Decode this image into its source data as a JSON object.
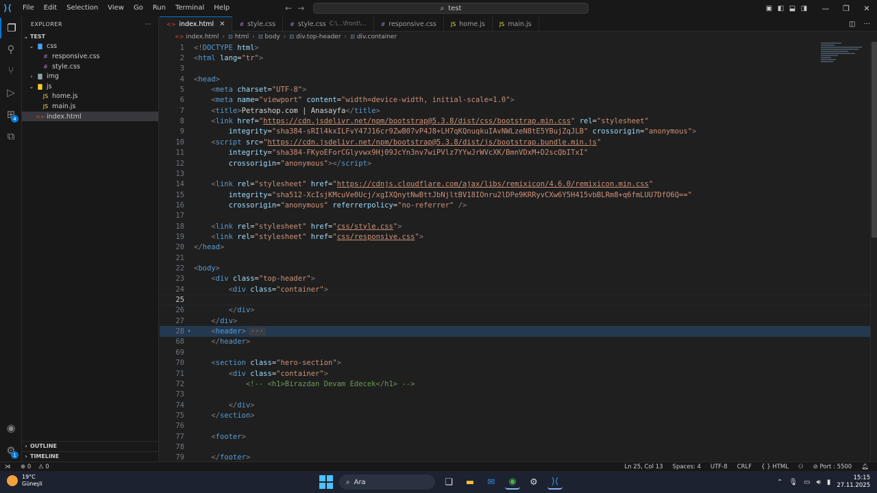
{
  "titlebar": {
    "menu": [
      "File",
      "Edit",
      "Selection",
      "View",
      "Go",
      "Run",
      "Terminal",
      "Help"
    ],
    "search": "test",
    "icons": [
      "vscode-logo",
      "back-arrow",
      "forward-arrow",
      "toggle-sidebar",
      "toggle-panel",
      "toggle-secondary-sidebar",
      "customize-layout",
      "minimize",
      "maximize",
      "close"
    ]
  },
  "activitybar": {
    "items": [
      "explorer",
      "search",
      "source-control",
      "run-and-debug",
      "extensions",
      "remote-explorer"
    ],
    "extensions_badge": "4",
    "manage_badge": "1"
  },
  "sidebar": {
    "title": "EXPLORER",
    "root": "TEST",
    "tree": [
      {
        "label": "css",
        "type": "folder-css",
        "depth": 1,
        "open": true
      },
      {
        "label": "responsive.css",
        "type": "css",
        "depth": 2
      },
      {
        "label": "style.css",
        "type": "css",
        "depth": 2
      },
      {
        "label": "img",
        "type": "folder",
        "depth": 1,
        "open": false
      },
      {
        "label": "js",
        "type": "folder-js",
        "depth": 1,
        "open": true
      },
      {
        "label": "home.js",
        "type": "js",
        "depth": 2
      },
      {
        "label": "main.js",
        "type": "js",
        "depth": 2
      },
      {
        "label": "index.html",
        "type": "html",
        "depth": 1,
        "selected": true
      }
    ],
    "outline": "OUTLINE",
    "timeline": "TIMELINE"
  },
  "tabs": [
    {
      "label": "index.html",
      "type": "html",
      "active": true,
      "desc": ""
    },
    {
      "label": "style.css",
      "type": "css",
      "active": false,
      "desc": ""
    },
    {
      "label": "style.css",
      "type": "css",
      "active": false,
      "desc": "C:\\...\\front\\..."
    },
    {
      "label": "responsive.css",
      "type": "css",
      "active": false,
      "desc": ""
    },
    {
      "label": "home.js",
      "type": "js",
      "active": false,
      "desc": ""
    },
    {
      "label": "main.js",
      "type": "js",
      "active": false,
      "desc": ""
    }
  ],
  "breadcrumb": [
    "index.html",
    "html",
    "body",
    "div.top-header",
    "div.container"
  ],
  "code_lines": [
    {
      "n": "1",
      "html": "<span class='t'>&lt;!</span><span class='tn'>DOCTYPE</span> <span class='an'>html</span><span class='t'>&gt;</span>"
    },
    {
      "n": "2",
      "html": "<span class='t'>&lt;</span><span class='tn'>html</span> <span class='an'>lang</span><span class='tx'>=</span><span class='av'>\"tr\"</span><span class='t'>&gt;</span>"
    },
    {
      "n": "3",
      "html": ""
    },
    {
      "n": "4",
      "html": "<span class='t'>&lt;</span><span class='tn'>head</span><span class='t'>&gt;</span>"
    },
    {
      "n": "5",
      "html": "    <span class='t'>&lt;</span><span class='tn'>meta</span> <span class='an'>charset</span><span class='tx'>=</span><span class='av'>\"UTF-8\"</span><span class='t'>&gt;</span>"
    },
    {
      "n": "6",
      "html": "    <span class='t'>&lt;</span><span class='tn'>meta</span> <span class='an'>name</span><span class='tx'>=</span><span class='av'>\"viewport\"</span> <span class='an'>content</span><span class='tx'>=</span><span class='av'>\"width=device-width, initial-scale=1.0\"</span><span class='t'>&gt;</span>"
    },
    {
      "n": "7",
      "html": "    <span class='t'>&lt;</span><span class='tn'>title</span><span class='t'>&gt;</span><span class='tx'>Petrashop.com | Anasayfa</span><span class='t'>&lt;/</span><span class='tn'>title</span><span class='t'>&gt;</span>"
    },
    {
      "n": "8",
      "html": "    <span class='t'>&lt;</span><span class='tn'>link</span> <span class='an'>href</span><span class='tx'>=</span><span class='av'>\"<span class='lk'>https://cdn.jsdelivr.net/npm/bootstrap@5.3.8/dist/css/bootstrap.min.css</span>\"</span> <span class='an'>rel</span><span class='tx'>=</span><span class='av'>\"stylesheet\"</span>"
    },
    {
      "n": "9",
      "html": "        <span class='an'>integrity</span><span class='tx'>=</span><span class='av'>\"sha384-sRIl4kxILFvY47J16cr9ZwB07vP4J8+LH7qKQnuqkuIAvNWLzeN8tE5YBujZqJLB\"</span> <span class='an'>crossorigin</span><span class='tx'>=</span><span class='av'>\"anonymous\"</span><span class='t'>&gt;</span>"
    },
    {
      "n": "10",
      "html": "    <span class='t'>&lt;</span><span class='tn'>script</span> <span class='an'>src</span><span class='tx'>=</span><span class='av'>\"<span class='lk'>https://cdn.jsdelivr.net/npm/bootstrap@5.3.8/dist/js/bootstrap.bundle.min.js</span>\"</span>"
    },
    {
      "n": "11",
      "html": "        <span class='an'>integrity</span><span class='tx'>=</span><span class='av'>\"sha384-FKyoEForCGlyvwx9Hj09JcYn3nv7wiPVlz7YYwJrWVcXK/BmnVDxM+D2scQbITxI\"</span>"
    },
    {
      "n": "12",
      "html": "        <span class='an'>crossorigin</span><span class='tx'>=</span><span class='av'>\"anonymous\"</span><span class='t'>&gt;&lt;/</span><span class='tn'>script</span><span class='t'>&gt;</span>"
    },
    {
      "n": "13",
      "html": ""
    },
    {
      "n": "14",
      "html": "    <span class='t'>&lt;</span><span class='tn'>link</span> <span class='an'>rel</span><span class='tx'>=</span><span class='av'>\"stylesheet\"</span> <span class='an'>href</span><span class='tx'>=</span><span class='av'>\"<span class='lk'>https://cdnjs.cloudflare.com/ajax/libs/remixicon/4.6.0/remixicon.min.css</span>\"</span>"
    },
    {
      "n": "15",
      "html": "        <span class='an'>integrity</span><span class='tx'>=</span><span class='av'>\"sha512-XcIsjKMcuVe0Ucj/xgIXQnytNwBttJbNjltBV18IOnru2lDPe9KRRyvCXw6Y5H415vbBLRm8+q6fmLUU7DfO6Q==\"</span>"
    },
    {
      "n": "16",
      "html": "        <span class='an'>crossorigin</span><span class='tx'>=</span><span class='av'>\"anonymous\"</span> <span class='an'>referrerpolicy</span><span class='tx'>=</span><span class='av'>\"no-referrer\"</span> <span class='t'>/&gt;</span>"
    },
    {
      "n": "17",
      "html": ""
    },
    {
      "n": "18",
      "html": "    <span class='t'>&lt;</span><span class='tn'>link</span> <span class='an'>rel</span><span class='tx'>=</span><span class='av'>\"stylesheet\"</span> <span class='an'>href</span><span class='tx'>=</span><span class='av'>\"<span class='lk'>css/style.css</span>\"</span><span class='t'>&gt;</span>"
    },
    {
      "n": "19",
      "html": "    <span class='t'>&lt;</span><span class='tn'>link</span> <span class='an'>rel</span><span class='tx'>=</span><span class='av'>\"stylesheet\"</span> <span class='an'>href</span><span class='tx'>=</span><span class='av'>\"<span class='lk'>css/responsive.css</span>\"</span><span class='t'>&gt;</span>"
    },
    {
      "n": "20",
      "html": "<span class='t'>&lt;/</span><span class='tn'>head</span><span class='t'>&gt;</span>"
    },
    {
      "n": "21",
      "html": ""
    },
    {
      "n": "22",
      "html": "<span class='t'>&lt;</span><span class='tn'>body</span><span class='t'>&gt;</span>"
    },
    {
      "n": "23",
      "html": "    <span class='t'>&lt;</span><span class='tn'>div</span> <span class='an'>class</span><span class='tx'>=</span><span class='av'>\"top-header\"</span><span class='t'>&gt;</span>"
    },
    {
      "n": "24",
      "html": "        <span class='t'>&lt;</span><span class='tn'>div</span> <span class='an'>class</span><span class='tx'>=</span><span class='av'>\"container\"</span><span class='t'>&gt;</span>"
    },
    {
      "n": "25",
      "html": "",
      "current": true
    },
    {
      "n": "26",
      "html": "        <span class='t'>&lt;/</span><span class='tn'>div</span><span class='t'>&gt;</span>"
    },
    {
      "n": "27",
      "html": "    <span class='t'>&lt;/</span><span class='tn'>div</span><span class='t'>&gt;</span>"
    },
    {
      "n": "28",
      "html": "    <span class='t'>&lt;</span><span class='tn'>header</span><span class='t'>&gt;</span><span class='fold-dots'>···</span>",
      "folded": true
    },
    {
      "n": "68",
      "html": "    <span class='t'>&lt;/</span><span class='tn'>header</span><span class='t'>&gt;</span>"
    },
    {
      "n": "69",
      "html": ""
    },
    {
      "n": "70",
      "html": "    <span class='t'>&lt;</span><span class='tn'>section</span> <span class='an'>class</span><span class='tx'>=</span><span class='av'>\"hero-section\"</span><span class='t'>&gt;</span>"
    },
    {
      "n": "71",
      "html": "        <span class='t'>&lt;</span><span class='tn'>div</span> <span class='an'>class</span><span class='tx'>=</span><span class='av'>\"container\"</span><span class='t'>&gt;</span>"
    },
    {
      "n": "72",
      "html": "            <span class='cm'>&lt;!-- &lt;h1&gt;Birazdan Devam Edecek&lt;/h1&gt; --&gt;</span>"
    },
    {
      "n": "73",
      "html": ""
    },
    {
      "n": "74",
      "html": "        <span class='t'>&lt;/</span><span class='tn'>div</span><span class='t'>&gt;</span>"
    },
    {
      "n": "75",
      "html": "    <span class='t'>&lt;/</span><span class='tn'>section</span><span class='t'>&gt;</span>"
    },
    {
      "n": "76",
      "html": ""
    },
    {
      "n": "77",
      "html": "    <span class='t'>&lt;</span><span class='tn'>footer</span><span class='t'>&gt;</span>"
    },
    {
      "n": "78",
      "html": ""
    },
    {
      "n": "79",
      "html": "    <span class='t'>&lt;/</span><span class='tn'>footer</span><span class='t'>&gt;</span>"
    }
  ],
  "statusbar": {
    "errors": "0",
    "warnings": "0",
    "position": "Ln 25, Col 13",
    "spaces": "Spaces: 4",
    "encoding": "UTF-8",
    "eol": "CRLF",
    "language": "HTML",
    "port": "Port : 5500"
  },
  "taskbar": {
    "temperature": "19°C",
    "weather": "Güneşli",
    "search": "Ara",
    "apps": [
      "start",
      "search",
      "widgets",
      "task-view",
      "file-explorer",
      "mail",
      "chrome",
      "steam",
      "vscode"
    ],
    "time": "15:15",
    "date": "27.11.2025"
  },
  "colors": {
    "accent": "#0078d4",
    "tag": "#569cd6",
    "attr": "#9cdcfe",
    "string": "#ce9178",
    "comment": "#6a9955"
  }
}
